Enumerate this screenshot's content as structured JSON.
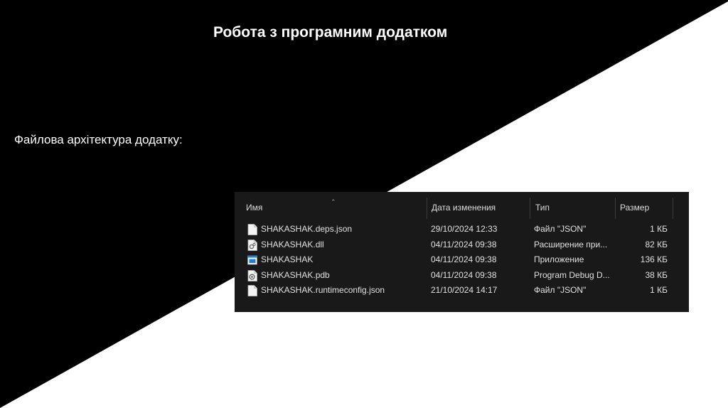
{
  "slide": {
    "title": "Робота з програмним додатком",
    "subtitle": "Файлова архітектура додатку:"
  },
  "explorer": {
    "columns": {
      "name": "Имя",
      "date": "Дата изменения",
      "type": "Тип",
      "size": "Размер"
    },
    "files": [
      {
        "name": "SHAKASHAK.deps.json",
        "date": "29/10/2024 12:33",
        "type": "Файл \"JSON\"",
        "size": "1 КБ",
        "icon": "json-file-icon"
      },
      {
        "name": "SHAKASHAK.dll",
        "date": "04/11/2024 09:38",
        "type": "Расширение при...",
        "size": "82 КБ",
        "icon": "dll-file-icon"
      },
      {
        "name": "SHAKASHAK",
        "date": "04/11/2024 09:38",
        "type": "Приложение",
        "size": "136 КБ",
        "icon": "application-icon"
      },
      {
        "name": "SHAKASHAK.pdb",
        "date": "04/11/2024 09:38",
        "type": "Program Debug D...",
        "size": "38 КБ",
        "icon": "pdb-file-icon"
      },
      {
        "name": "SHAKASHAK.runtimeconfig.json",
        "date": "21/10/2024 14:17",
        "type": "Файл \"JSON\"",
        "size": "1 КБ",
        "icon": "json-file-icon"
      }
    ]
  },
  "colors": {
    "slide_dark": "#000000",
    "slide_light": "#ffffff",
    "explorer_bg": "#191919",
    "app_icon_accent": "#1e7fd6"
  }
}
